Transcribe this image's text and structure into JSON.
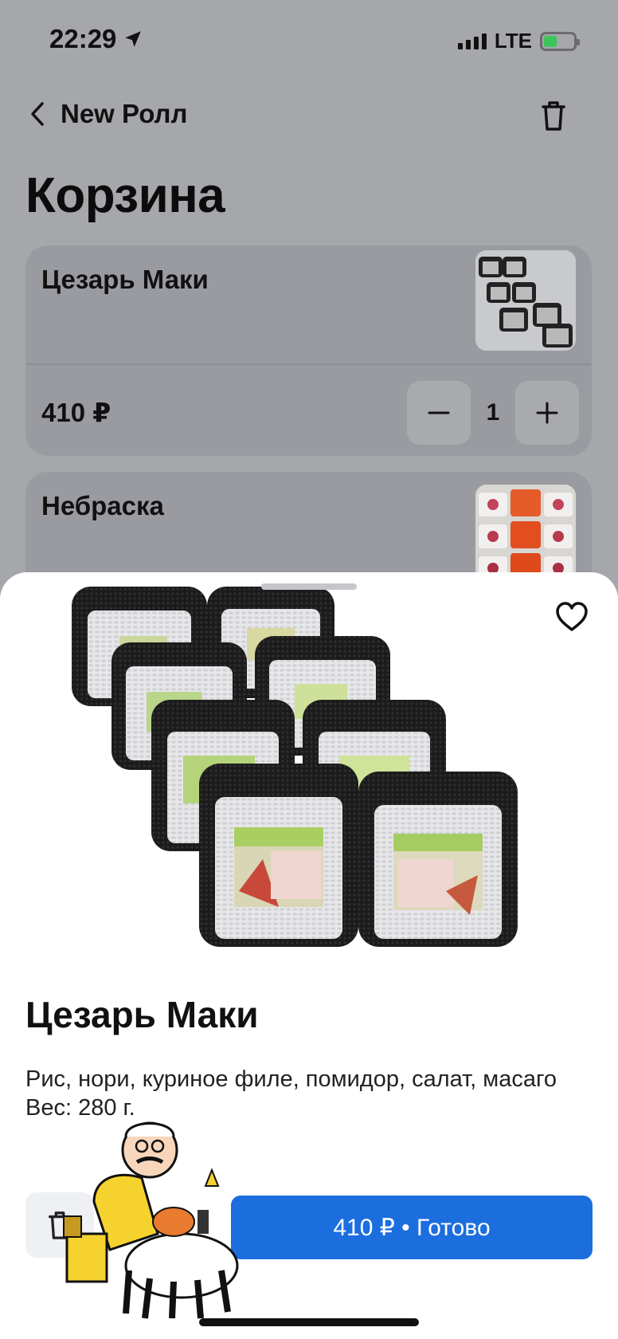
{
  "status": {
    "time": "22:29",
    "network": "LTE"
  },
  "header": {
    "back_label": "New Ролл",
    "title": "Корзина"
  },
  "cart": {
    "items": [
      {
        "name": "Цезарь Маки",
        "price": "410 ₽",
        "quantity": "1"
      },
      {
        "name": "Небраска"
      }
    ]
  },
  "sheet": {
    "title": "Цезарь Маки",
    "description": "Рис, нори, куриное филе, помидор, салат, масаго",
    "weight": "Вес: 280 г.",
    "cta_label": "410 ₽ • Готово"
  },
  "icons": {
    "back": "chevron-left-icon",
    "trash": "trash-icon",
    "favorite": "heart-icon",
    "minus": "minus-icon",
    "plus": "plus-icon",
    "location": "location-arrow-icon"
  },
  "colors": {
    "accent": "#1c6edf",
    "overlay": "#a6a7ab",
    "battery": "#3bc45a"
  }
}
